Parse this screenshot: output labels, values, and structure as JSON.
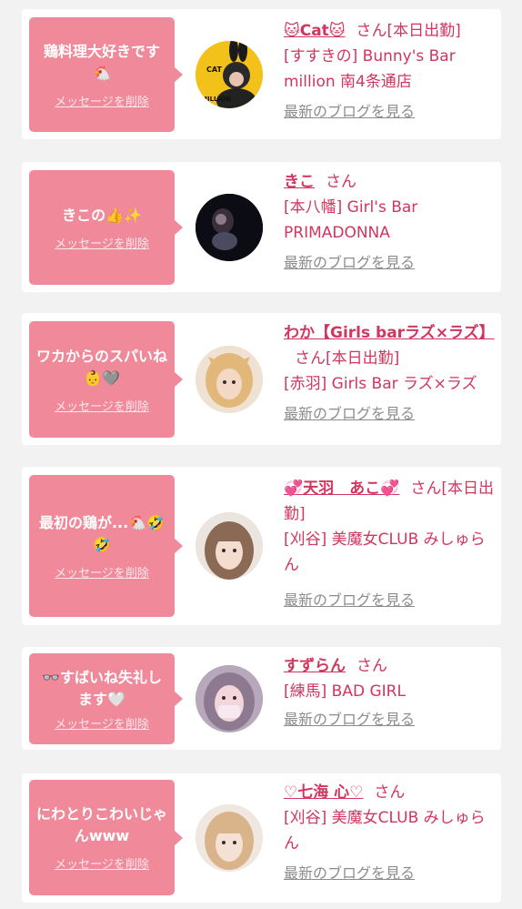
{
  "cards": [
    {
      "message": "鶏料理大好きです🐔",
      "delete_label": "メッセージを削除",
      "name": "🐱Cat🐱",
      "honorific": "さん",
      "status": "[本日出勤]",
      "shop": "[すすきの] Bunny's Bar million 南4条通店",
      "blog_label": "最新のブログを見る"
    },
    {
      "message": "きこの👍✨",
      "delete_label": "メッセージを削除",
      "name": "きこ",
      "honorific": "さん",
      "status": "",
      "shop": "[本八幡] Girl's Bar PRIMADONNA",
      "blog_label": "最新のブログを見る"
    },
    {
      "message": "ワカからのスパいね👶🩶",
      "delete_label": "メッセージを削除",
      "name": "わか【Girls barラズ×ラズ】",
      "honorific": "さん",
      "status": "[本日出勤]",
      "shop": "[赤羽] Girls Bar ラズ×ラズ",
      "blog_label": "最新のブログを見る"
    },
    {
      "message": "最初の鶏が...🐔🤣🤣",
      "delete_label": "メッセージを削除",
      "name": "💞天羽　あこ💞",
      "honorific": "さん",
      "status": "[本日出勤]",
      "shop": "[刈谷] 美魔女CLUB みしゅらん",
      "blog_label": "最新のブログを見る"
    },
    {
      "message": "👓すばいね失礼します🤍",
      "delete_label": "メッセージを削除",
      "name": "すずらん",
      "honorific": "さん",
      "status": "",
      "shop": "[練馬] BAD GIRL",
      "blog_label": "最新のブログを見る"
    },
    {
      "message": "にわとりこわいじゃんwww",
      "delete_label": "メッセージを削除",
      "name": "♡七海 心♡",
      "honorific": "さん",
      "status": "",
      "shop": "[刈谷] 美魔女CLUB みしゅらん",
      "blog_label": "最新のブログを見る"
    }
  ],
  "avatar_cat_text": "CAT",
  "avatar_million_text": "MILLION"
}
